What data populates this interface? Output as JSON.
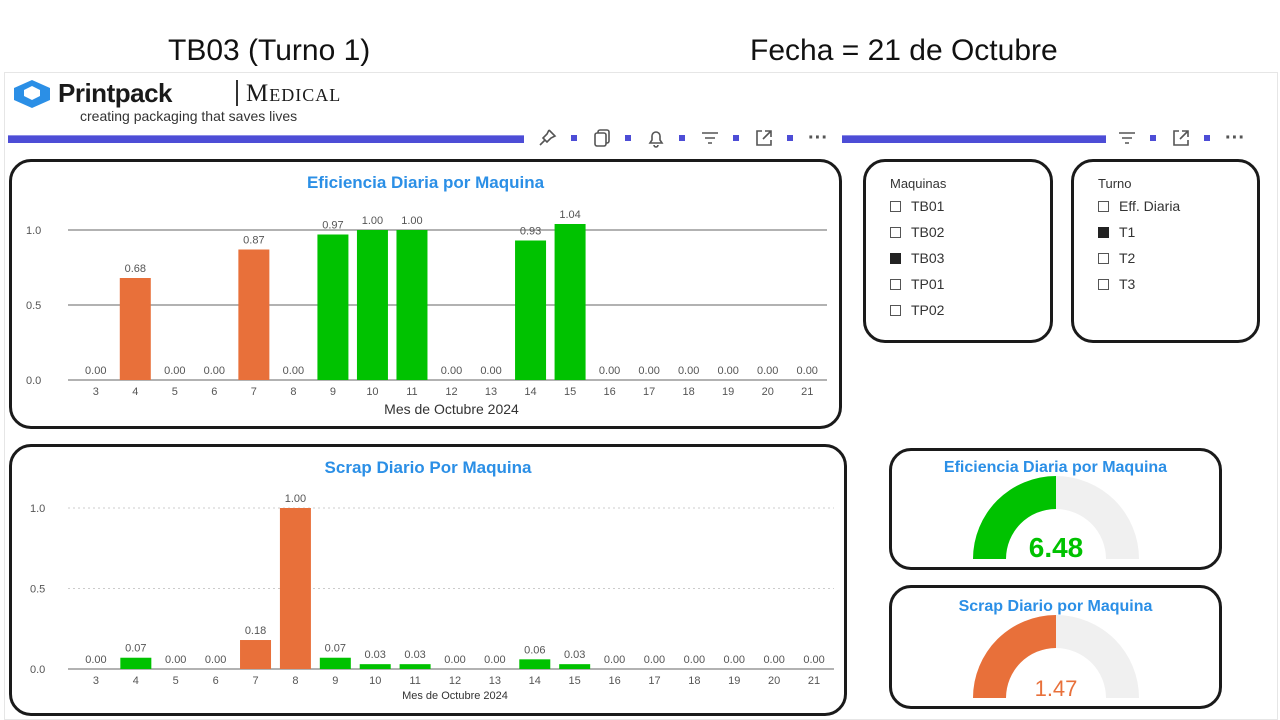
{
  "header": {
    "left_title": "TB03 (Turno 1)",
    "right_title": "Fecha = 21 de Octubre"
  },
  "logo": {
    "brand": "Printpack",
    "division": "Medical",
    "tagline": "creating packaging that saves lives"
  },
  "toolbar": {
    "icons": [
      "pin-icon",
      "copy-icon",
      "bell-icon",
      "filter-icon",
      "expand-icon",
      "more-icon"
    ],
    "right_icons": [
      "filter-icon",
      "expand-icon",
      "more-icon"
    ],
    "more_label": "···"
  },
  "colors": {
    "good": "#00c200",
    "bad": "#e8703a",
    "title": "#2b8fe6",
    "accent_bar": "#4d4dd6",
    "gauge_track": "#f0f0f0"
  },
  "chart_data": [
    {
      "type": "bar",
      "title": "Eficiencia Diaria por Maquina",
      "xlabel": "Mes de Octubre 2024",
      "ylabel": "",
      "categories": [
        "3",
        "4",
        "5",
        "6",
        "7",
        "8",
        "9",
        "10",
        "11",
        "12",
        "13",
        "14",
        "15",
        "16",
        "17",
        "18",
        "19",
        "20",
        "21"
      ],
      "values": [
        0.0,
        0.68,
        0.0,
        0.0,
        0.87,
        0.0,
        0.97,
        1.0,
        1.0,
        0.0,
        0.0,
        0.93,
        1.04,
        0.0,
        0.0,
        0.0,
        0.0,
        0.0,
        0.0
      ],
      "bar_colors": [
        "",
        "#e8703a",
        "",
        "",
        "#e8703a",
        "",
        "#00c200",
        "#00c200",
        "#00c200",
        "",
        "",
        "#00c200",
        "#00c200",
        "",
        "",
        "",
        "",
        "",
        ""
      ],
      "labels": [
        "0.00",
        "0.68",
        "0.00",
        "0.00",
        "0.87",
        "0.00",
        "0.97",
        "1.00",
        "1.00",
        "0.00",
        "0.00",
        "0.93",
        "1.04",
        "0.00",
        "0.00",
        "0.00",
        "0.00",
        "0.00",
        "0.00"
      ],
      "yticks": [
        "0.0",
        "0.5",
        "1.0"
      ],
      "ylim": [
        0,
        1.05
      ],
      "grid": "solid"
    },
    {
      "type": "bar",
      "title": "Scrap Diario Por Maquina",
      "xlabel": "Mes de Octubre 2024",
      "ylabel": "",
      "categories": [
        "3",
        "4",
        "5",
        "6",
        "7",
        "8",
        "9",
        "10",
        "11",
        "12",
        "13",
        "14",
        "15",
        "16",
        "17",
        "18",
        "19",
        "20",
        "21"
      ],
      "values": [
        0.0,
        0.07,
        0.0,
        0.0,
        0.18,
        1.0,
        0.07,
        0.03,
        0.03,
        0.0,
        0.0,
        0.06,
        0.03,
        0.0,
        0.0,
        0.0,
        0.0,
        0.0,
        0.0
      ],
      "bar_colors": [
        "",
        "#00c200",
        "",
        "",
        "#e8703a",
        "#e8703a",
        "#00c200",
        "#00c200",
        "#00c200",
        "",
        "",
        "#00c200",
        "#00c200",
        "",
        "",
        "",
        "",
        "",
        ""
      ],
      "labels": [
        "0.00",
        "0.07",
        "0.00",
        "0.00",
        "0.18",
        "1.00",
        "0.07",
        "0.03",
        "0.03",
        "0.00",
        "0.00",
        "0.06",
        "0.03",
        "0.00",
        "0.00",
        "0.00",
        "0.00",
        "0.00",
        "0.00"
      ],
      "yticks": [
        "0.0",
        "0.5",
        "1.0"
      ],
      "ylim": [
        0,
        1.0
      ],
      "grid": "dotted"
    }
  ],
  "slicers": {
    "maquinas": {
      "label": "Maquinas",
      "items": [
        {
          "label": "TB01",
          "checked": false
        },
        {
          "label": "TB02",
          "checked": false
        },
        {
          "label": "TB03",
          "checked": true
        },
        {
          "label": "TP01",
          "checked": false
        },
        {
          "label": "TP02",
          "checked": false
        }
      ]
    },
    "turno": {
      "label": "Turno",
      "items": [
        {
          "label": "Eff. Diaria",
          "checked": false
        },
        {
          "label": "T1",
          "checked": true
        },
        {
          "label": "T2",
          "checked": false
        },
        {
          "label": "T3",
          "checked": false
        }
      ]
    }
  },
  "gauges": {
    "eficiencia": {
      "title": "Eficiencia Diaria por Maquina",
      "value": "6.48",
      "fill_fraction": 0.5,
      "color": "#00c200"
    },
    "scrap": {
      "title": "Scrap Diario por Maquina",
      "value": "1.47",
      "fill_fraction": 0.5,
      "color": "#e8703a"
    }
  }
}
